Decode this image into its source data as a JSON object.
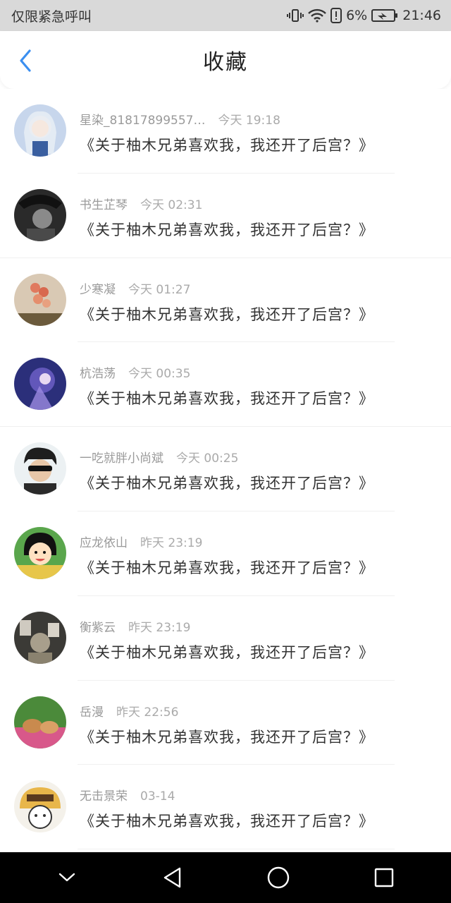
{
  "status_bar": {
    "carrier": "仅限紧急呼叫",
    "battery_percent": "6%",
    "time": "21:46",
    "icons": [
      "vibrate-icon",
      "wifi-icon",
      "alert-icon",
      "battery-icon"
    ]
  },
  "header": {
    "title": "收藏",
    "back_icon": "chevron-left-icon",
    "accent": "#3b8ff0"
  },
  "favorites": [
    {
      "user": "星染_81817899557…",
      "time": "今天 19:18",
      "title": "《关于柚木兄弟喜欢我，我还开了后宫？》"
    },
    {
      "user": "书生芷琴",
      "time": "今天 02:31",
      "title": "《关于柚木兄弟喜欢我，我还开了后宫？》"
    },
    {
      "user": "少寒凝",
      "time": "今天 01:27",
      "title": "《关于柚木兄弟喜欢我，我还开了后宫？》"
    },
    {
      "user": "杭浩荡",
      "time": "今天 00:35",
      "title": "《关于柚木兄弟喜欢我，我还开了后宫？》"
    },
    {
      "user": "一吃就胖小尚斌",
      "time": "今天 00:25",
      "title": "《关于柚木兄弟喜欢我，我还开了后宫？》"
    },
    {
      "user": "应龙依山",
      "time": "昨天 23:19",
      "title": "《关于柚木兄弟喜欢我，我还开了后宫？》"
    },
    {
      "user": "衡紫云",
      "time": "昨天 23:19",
      "title": "《关于柚木兄弟喜欢我，我还开了后宫？》"
    },
    {
      "user": "岳漫",
      "time": "昨天 22:56",
      "title": "《关于柚木兄弟喜欢我，我还开了后宫？》"
    },
    {
      "user": "无击景荣",
      "time": "03-14",
      "title": "《关于柚木兄弟喜欢我，我还开了后宫？》"
    }
  ],
  "nav_bar": {
    "icons": [
      "chevron-down-icon",
      "back-triangle-icon",
      "home-circle-icon",
      "recents-square-icon"
    ]
  }
}
